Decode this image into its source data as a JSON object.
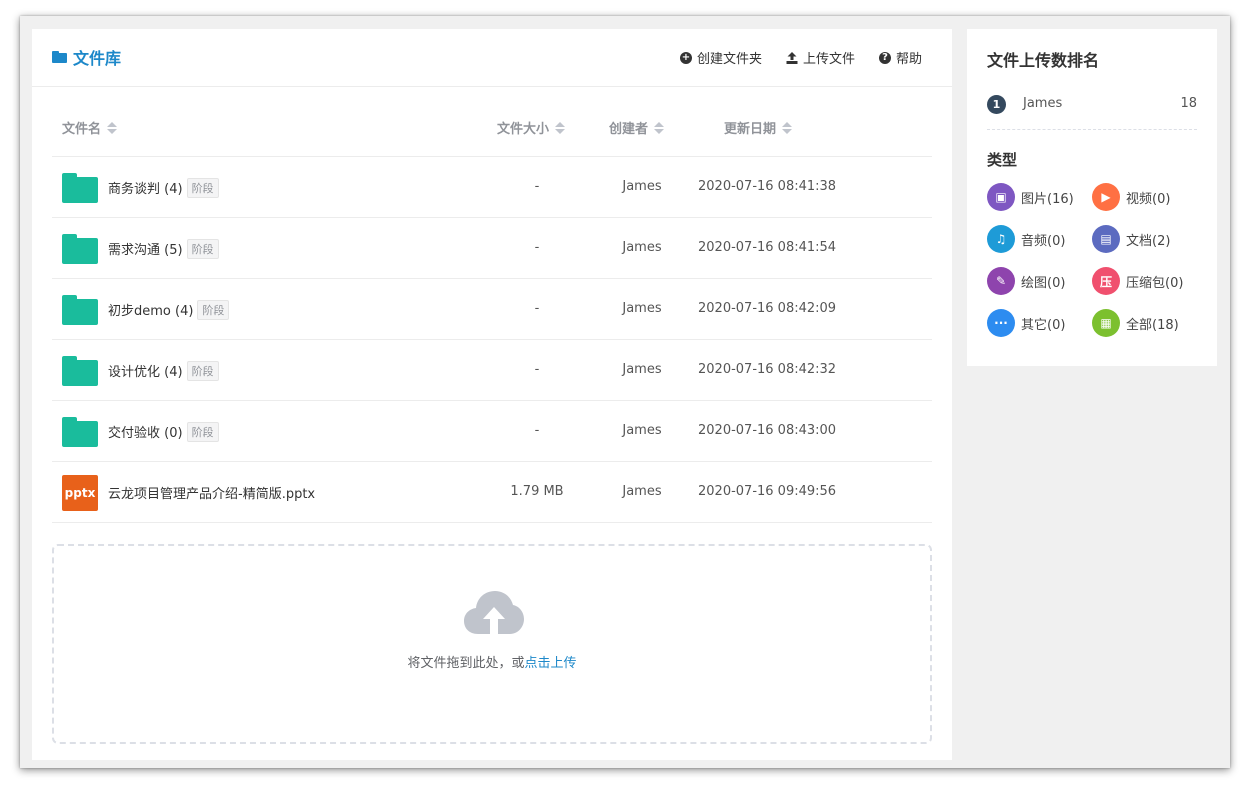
{
  "library": {
    "title": "文件库",
    "actions": [
      {
        "label": "创建文件夹",
        "icon": "plus-circle-icon"
      },
      {
        "label": "上传文件",
        "icon": "upload-icon"
      },
      {
        "label": "帮助",
        "icon": "question-circle-icon"
      }
    ]
  },
  "table": {
    "headers": {
      "name": "文件名",
      "size": "文件大小",
      "creator": "创建者",
      "date": "更新日期"
    },
    "rows": [
      {
        "type": "folder",
        "name": "商务谈判 (4)",
        "badge": "阶段",
        "size": "-",
        "creator": "James",
        "date": "2020-07-16 08:41:38"
      },
      {
        "type": "folder",
        "name": "需求沟通 (5)",
        "badge": "阶段",
        "size": "-",
        "creator": "James",
        "date": "2020-07-16 08:41:54"
      },
      {
        "type": "folder",
        "name": "初步demo (4)",
        "badge": "阶段",
        "size": "-",
        "creator": "James",
        "date": "2020-07-16 08:42:09"
      },
      {
        "type": "folder",
        "name": "设计优化 (4)",
        "badge": "阶段",
        "size": "-",
        "creator": "James",
        "date": "2020-07-16 08:42:32"
      },
      {
        "type": "folder",
        "name": "交付验收 (0)",
        "badge": "阶段",
        "size": "-",
        "creator": "James",
        "date": "2020-07-16 08:43:00"
      },
      {
        "type": "pptx",
        "icon_text": "pptx",
        "name": "云龙项目管理产品介绍-精简版.pptx",
        "badge": "",
        "size": "1.79 MB",
        "creator": "James",
        "date": "2020-07-16 09:49:56"
      }
    ]
  },
  "dropzone": {
    "text": "将文件拖到此处，或",
    "link": "点击上传"
  },
  "side": {
    "title": "文件上传数排名",
    "ranking": [
      {
        "rank": "1",
        "name": "James",
        "count": "18"
      }
    ],
    "types_title": "类型",
    "types": [
      {
        "label": "图片(16)",
        "color": "#7e57c2",
        "icon": "image-icon",
        "glyph": "▣"
      },
      {
        "label": "视频(0)",
        "color": "#ff7043",
        "icon": "video-icon",
        "glyph": "▶"
      },
      {
        "label": "音频(0)",
        "color": "#1e9bd7",
        "icon": "music-icon",
        "glyph": "♫"
      },
      {
        "label": "文档(2)",
        "color": "#5c6bc0",
        "icon": "document-icon",
        "glyph": "▤"
      },
      {
        "label": "绘图(0)",
        "color": "#8e44ad",
        "icon": "drawing-icon",
        "glyph": "✎"
      },
      {
        "label": "压缩包(0)",
        "color": "#f0506e",
        "icon": "archive-icon",
        "glyph": "压"
      },
      {
        "label": "其它(0)",
        "color": "#2d8cf0",
        "icon": "more-icon",
        "glyph": "···"
      },
      {
        "label": "全部(18)",
        "color": "#7cc02f",
        "icon": "grid-icon",
        "glyph": "▦"
      }
    ]
  }
}
